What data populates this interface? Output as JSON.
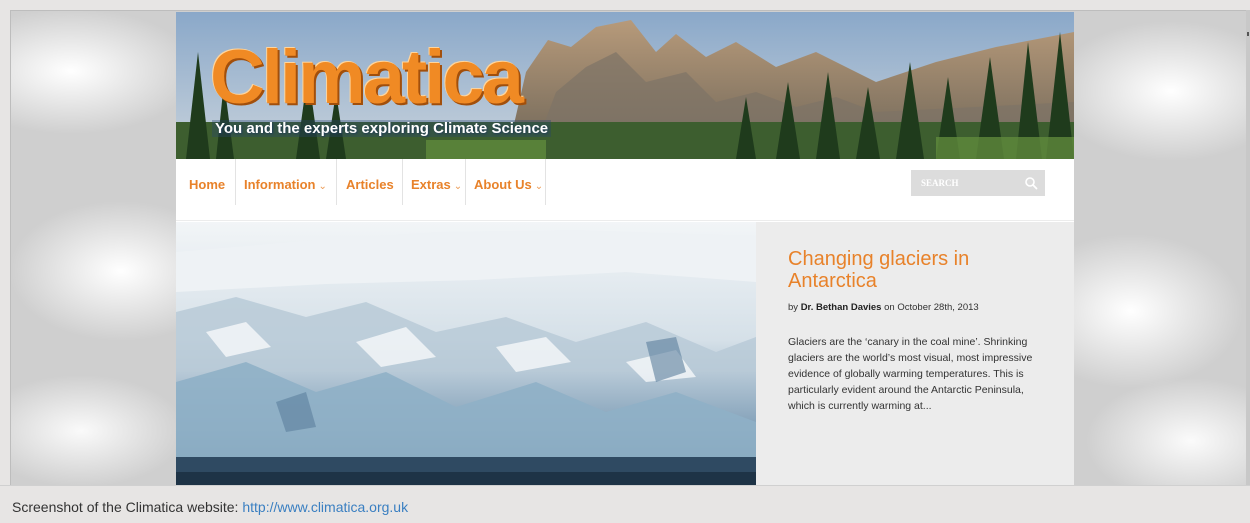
{
  "site": {
    "title": "Climatica",
    "tagline": "You and the experts exploring Climate Science"
  },
  "nav": {
    "items": [
      {
        "label": "Home",
        "has_dropdown": false
      },
      {
        "label": "Information",
        "has_dropdown": true
      },
      {
        "label": "Articles",
        "has_dropdown": false
      },
      {
        "label": "Extras",
        "has_dropdown": true
      },
      {
        "label": "About Us",
        "has_dropdown": true
      }
    ],
    "search_placeholder": "SEARCH"
  },
  "feature": {
    "headline": "Changing glaciers in Antarctica",
    "byline_prefix": "by",
    "author": "Dr. Bethan Davies",
    "byline_on": "on",
    "date": "October 28th, 2013",
    "excerpt": "Glaciers are the ‘canary in the coal mine’. Shrinking glaciers are the world’s most visual, most impressive evidence of globally warming temperatures. This is particularly evident around the Antarctic Peninsula, which is currently warming at..."
  },
  "caption": {
    "text": "Screenshot of the Climatica website:",
    "link": "http://www.climatica.org.uk"
  },
  "colors": {
    "accent": "#e8822a",
    "link": "#3a7fc1",
    "search_bg": "#dcdcdc",
    "sidebar_bg": "#ececec"
  },
  "icons": {
    "search": "search-icon",
    "dropdown": "chevron-down-icon"
  }
}
